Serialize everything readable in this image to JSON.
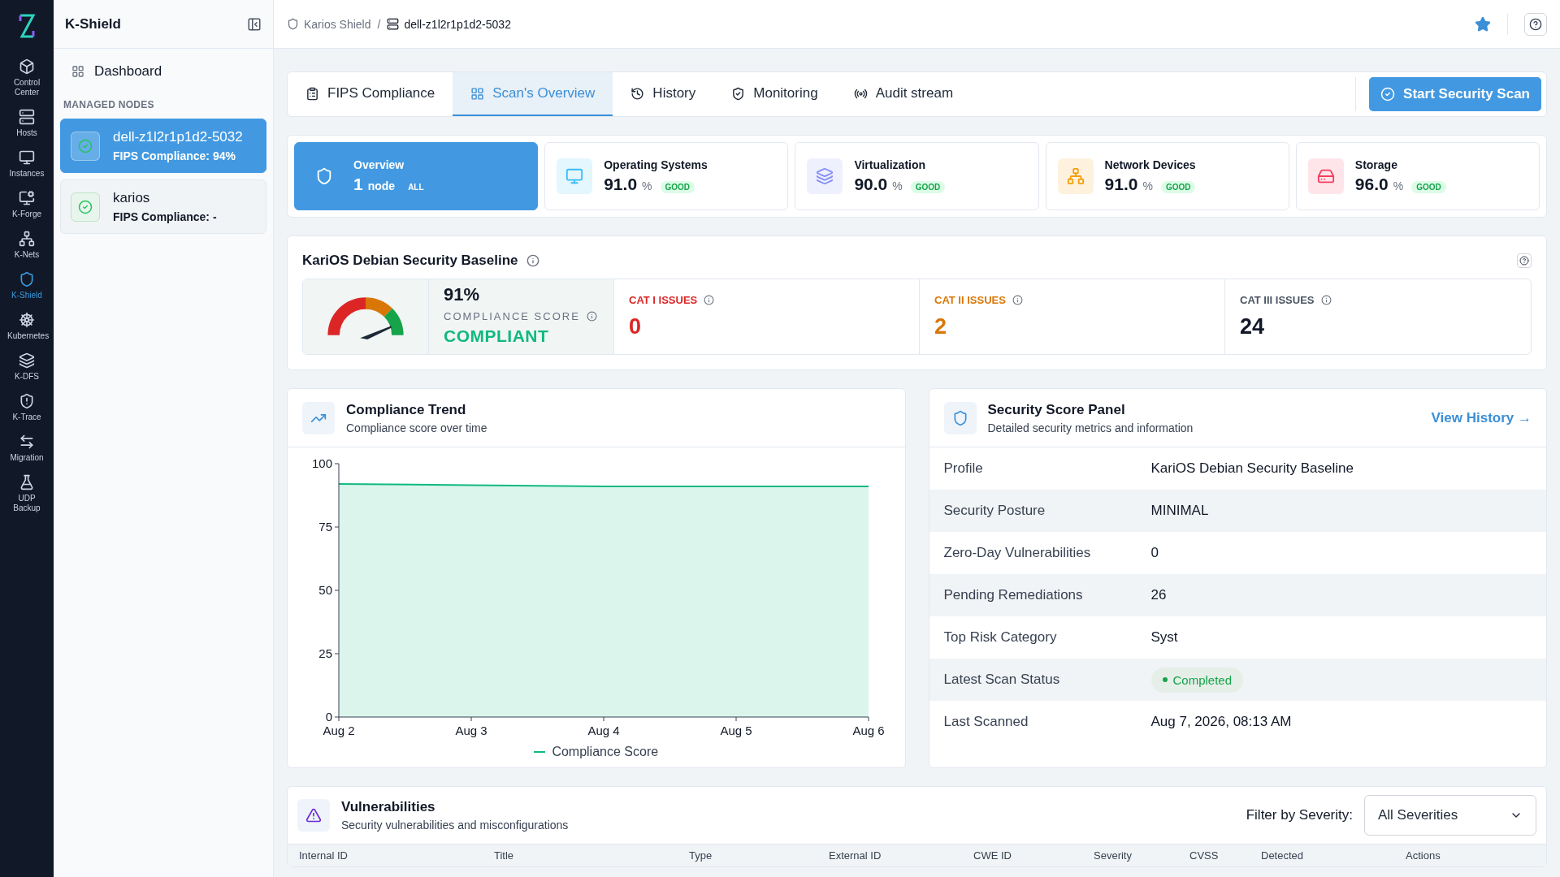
{
  "rail": {
    "items": [
      {
        "label": "Control Center",
        "selected": false
      },
      {
        "label": "Hosts",
        "selected": false
      },
      {
        "label": "Instances",
        "selected": false
      },
      {
        "label": "K-Forge",
        "selected": false
      },
      {
        "label": "K-Nets",
        "selected": false
      },
      {
        "label": "K-Shield",
        "selected": true
      },
      {
        "label": "Kubernetes",
        "selected": false
      },
      {
        "label": "K-DFS",
        "selected": false
      },
      {
        "label": "K-Trace",
        "selected": false
      },
      {
        "label": "Migration",
        "selected": false
      },
      {
        "label": "UDP Backup",
        "selected": false
      }
    ]
  },
  "sidebar": {
    "title": "K-Shield",
    "nav": "Dashboard",
    "section": "MANAGED NODES",
    "nodes": [
      {
        "name": "dell-z1l2r1p1d2-5032",
        "compliance": "FIPS Compliance: 94%",
        "selected": true
      },
      {
        "name": "karios",
        "compliance": "FIPS Compliance: -",
        "selected": false
      }
    ]
  },
  "breadcrumb": {
    "items": [
      "Karios Shield",
      "dell-z1l2r1p1d2-5032"
    ],
    "separator": "/"
  },
  "tabs": [
    {
      "label": "FIPS Compliance",
      "selected": false
    },
    {
      "label": "Scan's Overview",
      "selected": true
    },
    {
      "label": "History",
      "selected": false
    },
    {
      "label": "Monitoring",
      "selected": false
    },
    {
      "label": "Audit stream",
      "selected": false
    }
  ],
  "action_button": "Start Security Scan",
  "summary_cards": [
    {
      "title": "Overview",
      "value": "1",
      "unit": "node",
      "badge": "ALL",
      "selected": true,
      "color": "#ffffff"
    },
    {
      "title": "Operating Systems",
      "value": "91.0",
      "unit": "%",
      "badge": "GOOD",
      "selected": false,
      "color": "#38bdf8"
    },
    {
      "title": "Virtualization",
      "value": "90.0",
      "unit": "%",
      "badge": "GOOD",
      "selected": false,
      "color": "#818cf8"
    },
    {
      "title": "Network Devices",
      "value": "91.0",
      "unit": "%",
      "badge": "GOOD",
      "selected": false,
      "color": "#f59e0b"
    },
    {
      "title": "Storage",
      "value": "96.0",
      "unit": "%",
      "badge": "GOOD",
      "selected": false,
      "color": "#f43f5e"
    }
  ],
  "baseline": {
    "title": "KariOS Debian Security Baseline",
    "score": "91%",
    "score_label": "COMPLIANCE SCORE",
    "status": "COMPLIANT",
    "issues": [
      {
        "label": "CAT I ISSUES",
        "count": "0",
        "color": "#dc2626"
      },
      {
        "label": "CAT II ISSUES",
        "count": "2",
        "color": "#d97706"
      },
      {
        "label": "CAT III ISSUES",
        "count": "24",
        "color": "#111827"
      }
    ]
  },
  "trend": {
    "title": "Compliance Trend",
    "subtitle": "Compliance score over time",
    "chart_data": {
      "type": "line",
      "categories": [
        "Aug 2",
        "Aug 3",
        "Aug 4",
        "Aug 5",
        "Aug 6"
      ],
      "ylim": [
        0,
        100
      ],
      "yticks": [
        0,
        25,
        50,
        75,
        100
      ],
      "series": [
        {
          "name": "Compliance Score",
          "color": "#10b981",
          "values": [
            92,
            91.5,
            91,
            91,
            91
          ]
        }
      ]
    }
  },
  "security_panel": {
    "title": "Security Score Panel",
    "subtitle": "Detailed security metrics and information",
    "link": "View History →",
    "rows": [
      {
        "label": "Profile",
        "value": "KariOS Debian Security Baseline",
        "kind": "text"
      },
      {
        "label": "Security Posture",
        "value": "MINIMAL",
        "kind": "text"
      },
      {
        "label": "Zero-Day Vulnerabilities",
        "value": "0",
        "kind": "text"
      },
      {
        "label": "Pending Remediations",
        "value": "26",
        "kind": "text"
      },
      {
        "label": "Top Risk Category",
        "value": "Syst",
        "kind": "text"
      },
      {
        "label": "Latest Scan Status",
        "value": "Completed",
        "kind": "status"
      },
      {
        "label": "Last Scanned",
        "value": "Aug 7, 2026, 08:13 AM",
        "kind": "text"
      }
    ]
  },
  "vulnerabilities": {
    "title": "Vulnerabilities",
    "subtitle": "Security vulnerabilities and misconfigurations",
    "filter_label": "Filter by Severity:",
    "filter_value": "All Severities",
    "columns": [
      "Internal ID",
      "Title",
      "Type",
      "External ID",
      "CWE ID",
      "Severity",
      "CVSS",
      "Detected",
      "Actions"
    ]
  }
}
